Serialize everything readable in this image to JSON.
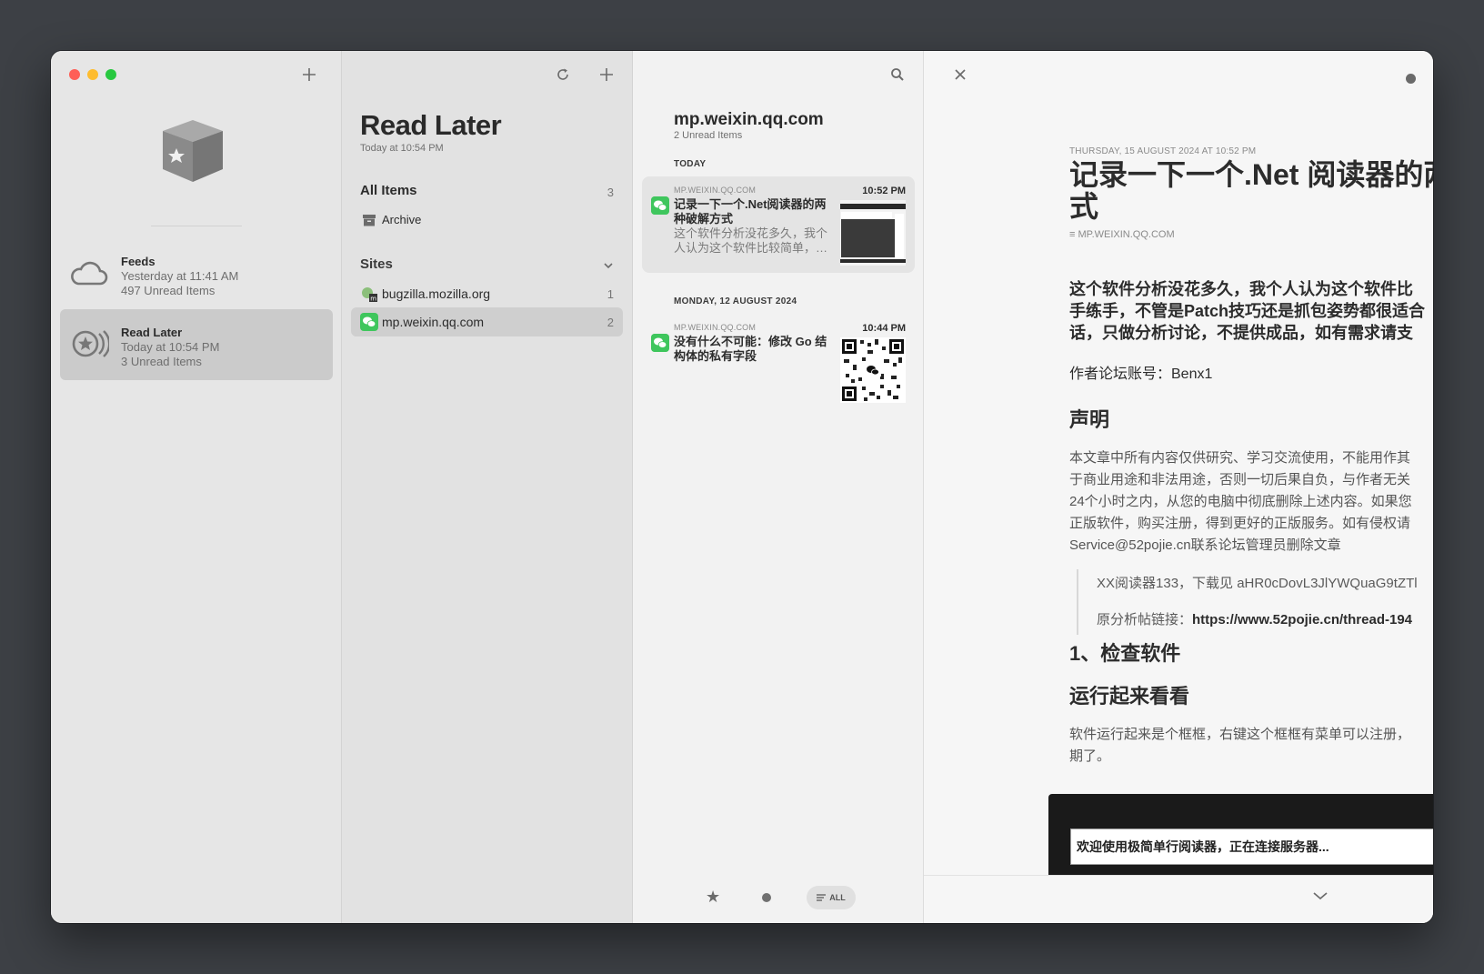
{
  "accounts": [
    {
      "name": "Feeds",
      "updated": "Yesterday at 11:41 AM",
      "unread": "497 Unread Items"
    },
    {
      "name": "Read Later",
      "updated": "Today at 10:54 PM",
      "unread": "3 Unread Items"
    }
  ],
  "middle": {
    "title": "Read Later",
    "updated": "Today at 10:54 PM",
    "all_items": {
      "label": "All Items",
      "count": "3"
    },
    "archive_label": "Archive",
    "sites_header": "Sites",
    "sites": [
      {
        "name": "bugzilla.mozilla.org",
        "count": "1"
      },
      {
        "name": "mp.weixin.qq.com",
        "count": "2"
      }
    ]
  },
  "list": {
    "title": "mp.weixin.qq.com",
    "subtitle": "2 Unread Items",
    "groups": [
      {
        "header": "TODAY",
        "articles": [
          {
            "source": "MP.WEIXIN.QQ.COM",
            "time": "10:52 PM",
            "title": "记录一下一个.Net阅读器的两种破解方式",
            "summary": "这个软件分析没花多久，我个人认为这个软件比较简单，…"
          }
        ]
      },
      {
        "header": "MONDAY, 12 AUGUST 2024",
        "articles": [
          {
            "source": "MP.WEIXIN.QQ.COM",
            "time": "10:44 PM",
            "title": "没有什么不可能：修改 Go 结构体的私有字段",
            "summary": ""
          }
        ]
      }
    ],
    "filter_all": "ALL"
  },
  "article": {
    "meta": "THURSDAY, 15 AUGUST 2024 AT 10:52 PM",
    "title_line1": "记录一下一个.Net 阅读器的两",
    "title_line2": "式",
    "source": "MP.WEIXIN.QQ.COM",
    "lead": [
      "这个软件分析没花多久，我个人认为这个软件比",
      "手练手，不管是Patch技巧还是抓包姿势都很适合",
      "话，只做分析讨论，不提供成品，如有需求请支"
    ],
    "author": "作者论坛账号：Benx1",
    "h_statement": "声明",
    "statement": [
      "本文章中所有内容仅供研究、学习交流使用，不能用作其",
      "于商业用途和非法用途，否则一切后果自负，与作者无关",
      "24个小时之内，从您的电脑中彻底删除上述内容。如果您",
      "正版软件，购买注册，得到更好的正版服务。如有侵权请",
      "Service@52pojie.cn联系论坛管理员删除文章"
    ],
    "quote1": "XX阅读器133，下载见 aHR0cDovL3JlYWQuaG9tZTl",
    "quote2_label": "原分析帖链接：",
    "quote2_link": "https://www.52pojie.cn/thread-194",
    "h_check": "1、检查软件",
    "h_run": "运行起来看看",
    "run_text": [
      "软件运行起来是个框框，右键这个框框有菜单可以注册，",
      "期了。"
    ],
    "screenshot_text": "欢迎使用极简单行阅读器，正在连接服务器..."
  }
}
